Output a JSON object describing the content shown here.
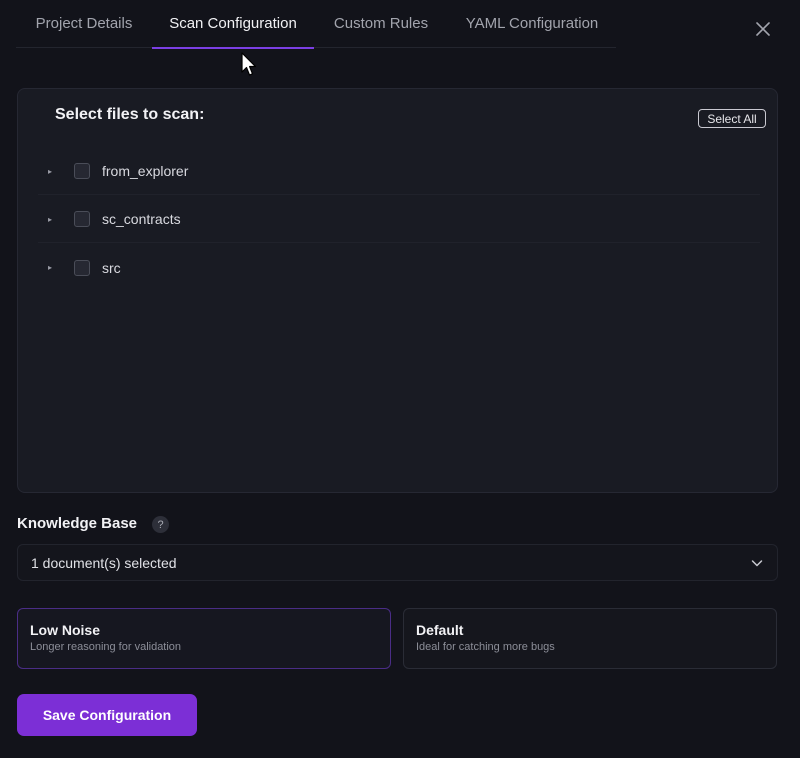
{
  "tabs": [
    {
      "label": "Project Details"
    },
    {
      "label": "Scan Configuration"
    },
    {
      "label": "Custom Rules"
    },
    {
      "label": "YAML Configuration"
    }
  ],
  "active_tab": "Scan Configuration",
  "files": {
    "title": "Select files to scan:",
    "select_all_label": "Select All",
    "items": [
      {
        "name": "from_explorer"
      },
      {
        "name": "sc_contracts"
      },
      {
        "name": "src"
      }
    ]
  },
  "knowledge_base": {
    "label": "Knowledge Base",
    "help": "?",
    "selected_text": "1 document(s) selected"
  },
  "modes": [
    {
      "title": "Low Noise",
      "description": "Longer reasoning for validation",
      "selected": true
    },
    {
      "title": "Default",
      "description": "Ideal for catching more bugs",
      "selected": false
    }
  ],
  "save_label": "Save Configuration",
  "colors": {
    "background": "#12131a",
    "accent": "#7c2fd6",
    "panel": "#191b23"
  },
  "icons": {
    "close": "close-icon",
    "caret": "caret-right-icon",
    "chevron": "chevron-down-icon",
    "help": "help-icon"
  }
}
